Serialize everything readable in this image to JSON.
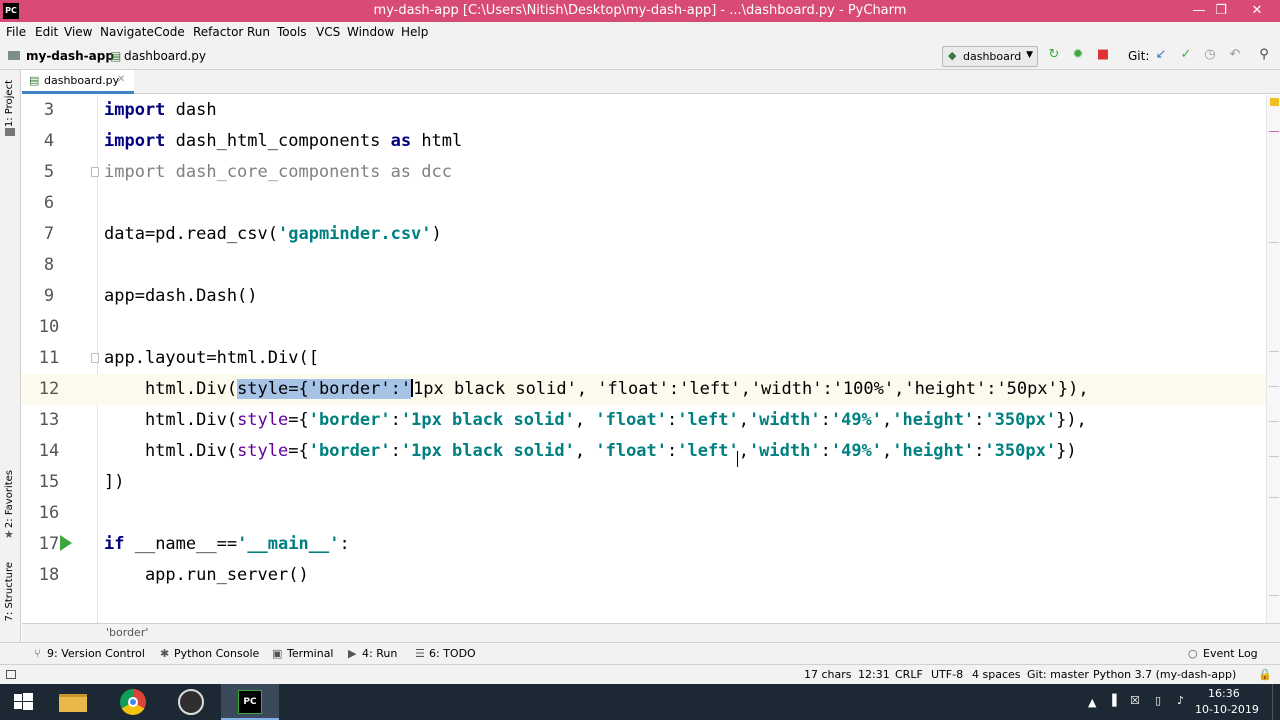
{
  "window": {
    "title": "my-dash-app [C:\\Users\\Nitish\\Desktop\\my-dash-app] - ...\\dashboard.py - PyCharm",
    "app_icon": "PC"
  },
  "menu": [
    "File",
    "Edit",
    "View",
    "Navigate",
    "Code",
    "Refactor",
    "Run",
    "Tools",
    "VCS",
    "Window",
    "Help"
  ],
  "nav": {
    "project": "my-dash-app",
    "file": "dashboard.py",
    "run_config": "dashboard",
    "git_label": "Git:"
  },
  "sidebar": {
    "project_label": "1: Project",
    "favorites_label": "2: Favorites",
    "structure_label": "7: Structure"
  },
  "tab": {
    "label": "dashboard.py"
  },
  "editor": {
    "lines": [
      {
        "n": "3",
        "tokens": [
          [
            "kw",
            "import"
          ],
          [
            "",
            " dash"
          ]
        ]
      },
      {
        "n": "4",
        "tokens": [
          [
            "kw",
            "import"
          ],
          [
            "",
            " dash_html_components "
          ],
          [
            "kw",
            "as"
          ],
          [
            "",
            " html"
          ]
        ]
      },
      {
        "n": "5",
        "tokens": [
          [
            "gray",
            "import dash_core_components as dcc"
          ]
        ]
      },
      {
        "n": "6",
        "tokens": []
      },
      {
        "n": "7",
        "tokens": [
          [
            "",
            "data=pd.read_csv("
          ],
          [
            "str",
            "'gapminder.csv'"
          ],
          [
            "",
            ")"
          ]
        ]
      },
      {
        "n": "8",
        "tokens": []
      },
      {
        "n": "9",
        "tokens": [
          [
            "",
            "app=dash.Dash()"
          ]
        ]
      },
      {
        "n": "10",
        "tokens": []
      },
      {
        "n": "11",
        "tokens": [
          [
            "",
            "app.layout=html.Div(["
          ]
        ]
      },
      {
        "n": "12",
        "tokens": [
          [
            "",
            "    html.Div("
          ],
          [
            "sel",
            "style={'border':'"
          ],
          [
            "",
            "1px black solid', 'float':'left','width':'100%','height':'50px'}),"
          ]
        ]
      },
      {
        "n": "13",
        "tokens": [
          [
            "",
            "    html.Div("
          ],
          [
            "param",
            "style"
          ],
          [
            "",
            "={"
          ],
          [
            "str",
            "'border'"
          ],
          [
            "",
            ":"
          ],
          [
            "str",
            "'1px black solid'"
          ],
          [
            "",
            ", "
          ],
          [
            "str",
            "'float'"
          ],
          [
            "",
            ":"
          ],
          [
            "str",
            "'left'"
          ],
          [
            "",
            ","
          ],
          [
            "str",
            "'width'"
          ],
          [
            "",
            ":"
          ],
          [
            "str",
            "'49%'"
          ],
          [
            "",
            ","
          ],
          [
            "str",
            "'height'"
          ],
          [
            "",
            ":"
          ],
          [
            "str",
            "'350px'"
          ],
          [
            "",
            "}),"
          ]
        ]
      },
      {
        "n": "14",
        "tokens": [
          [
            "",
            "    html.Div("
          ],
          [
            "param",
            "style"
          ],
          [
            "",
            "={"
          ],
          [
            "str",
            "'border'"
          ],
          [
            "",
            ":"
          ],
          [
            "str",
            "'1px black solid'"
          ],
          [
            "",
            ", "
          ],
          [
            "str",
            "'float'"
          ],
          [
            "",
            ":"
          ],
          [
            "str",
            "'left'"
          ],
          [
            "",
            ","
          ],
          [
            "str",
            "'width'"
          ],
          [
            "",
            ":"
          ],
          [
            "str",
            "'49%'"
          ],
          [
            "",
            ","
          ],
          [
            "str",
            "'height'"
          ],
          [
            "",
            ":"
          ],
          [
            "str",
            "'350px'"
          ],
          [
            "",
            "})"
          ]
        ]
      },
      {
        "n": "15",
        "tokens": [
          [
            "",
            "])"
          ]
        ]
      },
      {
        "n": "16",
        "tokens": []
      },
      {
        "n": "17",
        "tokens": [
          [
            "kw",
            "if"
          ],
          [
            "",
            " __name__=="
          ],
          [
            "str",
            "'__main__'"
          ],
          [
            "",
            ":"
          ]
        ]
      },
      {
        "n": "18",
        "tokens": [
          [
            "",
            "    app.run_server()"
          ]
        ]
      }
    ],
    "hint": "'border'"
  },
  "toolwindows": {
    "version_control": "9: Version Control",
    "python_console": "Python Console",
    "terminal": "Terminal",
    "run": "4: Run",
    "todo": "6: TODO",
    "event_log": "Event Log"
  },
  "status": {
    "chars": "17 chars",
    "position": "12:31",
    "line_sep": "CRLF",
    "encoding": "UTF-8",
    "indent": "4 spaces",
    "git": "Git: master",
    "interpreter": "Python 3.7 (my-dash-app)"
  },
  "taskbar": {
    "time": "16:36",
    "date": "10-10-2019"
  },
  "colors": {
    "titlebar": "#d84b76",
    "keyword": "#000080",
    "string": "#008080",
    "selection": "#a6c3e6",
    "current_line": "#fcfaed"
  }
}
